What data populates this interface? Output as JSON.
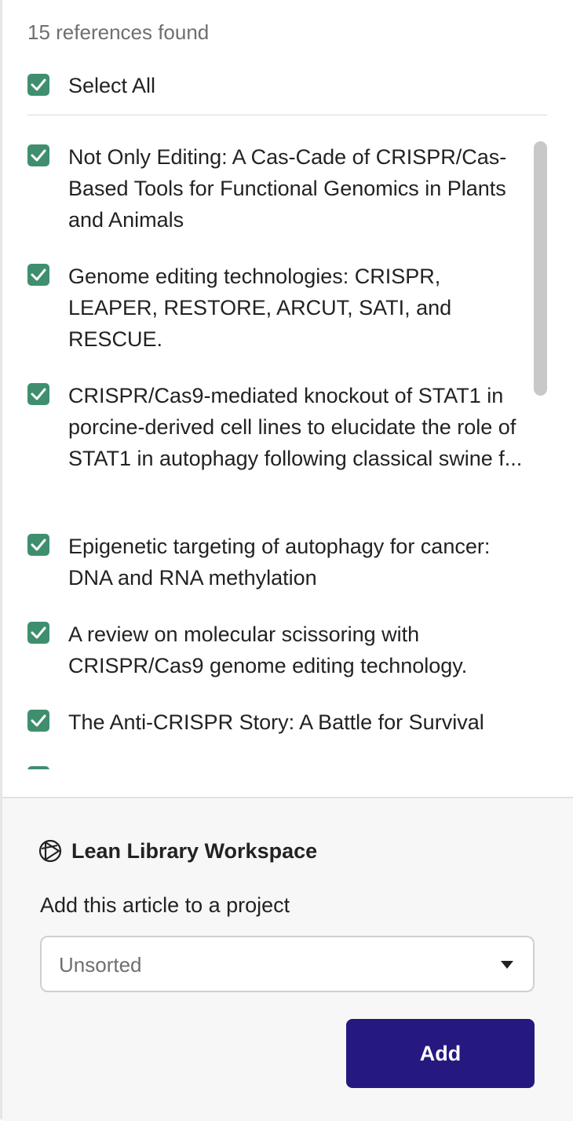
{
  "header": {
    "count_text": "15 references found",
    "select_all_label": "Select All",
    "select_all_checked": true
  },
  "references": [
    {
      "title": "Not Only Editing: A Cas-Cade of CRISPR/Cas-Based Tools for Functional Genomics in Plants and Animals",
      "checked": true
    },
    {
      "title": "Genome editing technologies: CRISPR, LEAPER, RESTORE, ARCUT, SATI, and RESCUE.",
      "checked": true
    },
    {
      "title": "CRISPR/Cas9-mediated knockout of STAT1 in porcine-derived cell lines to elucidate the role of STAT1 in autophagy following classical swine f...",
      "checked": true
    },
    {
      "title": "Epigenetic targeting of autophagy for cancer: DNA and RNA methylation",
      "checked": true
    },
    {
      "title": "A review on molecular scissoring with CRISPR/Cas9 genome editing technology.",
      "checked": true
    },
    {
      "title": "The Anti-CRISPR Story: A Battle for Survival",
      "checked": true
    }
  ],
  "workspace": {
    "icon": "lean-library-logo-icon",
    "title": "Lean Library Workspace",
    "project_label": "Add this article to a project",
    "project_selected": "Unsorted",
    "add_button_label": "Add"
  },
  "colors": {
    "checkbox": "#3f8f6e",
    "add_button": "#25197f",
    "footer_bg": "#f7f7f7"
  }
}
